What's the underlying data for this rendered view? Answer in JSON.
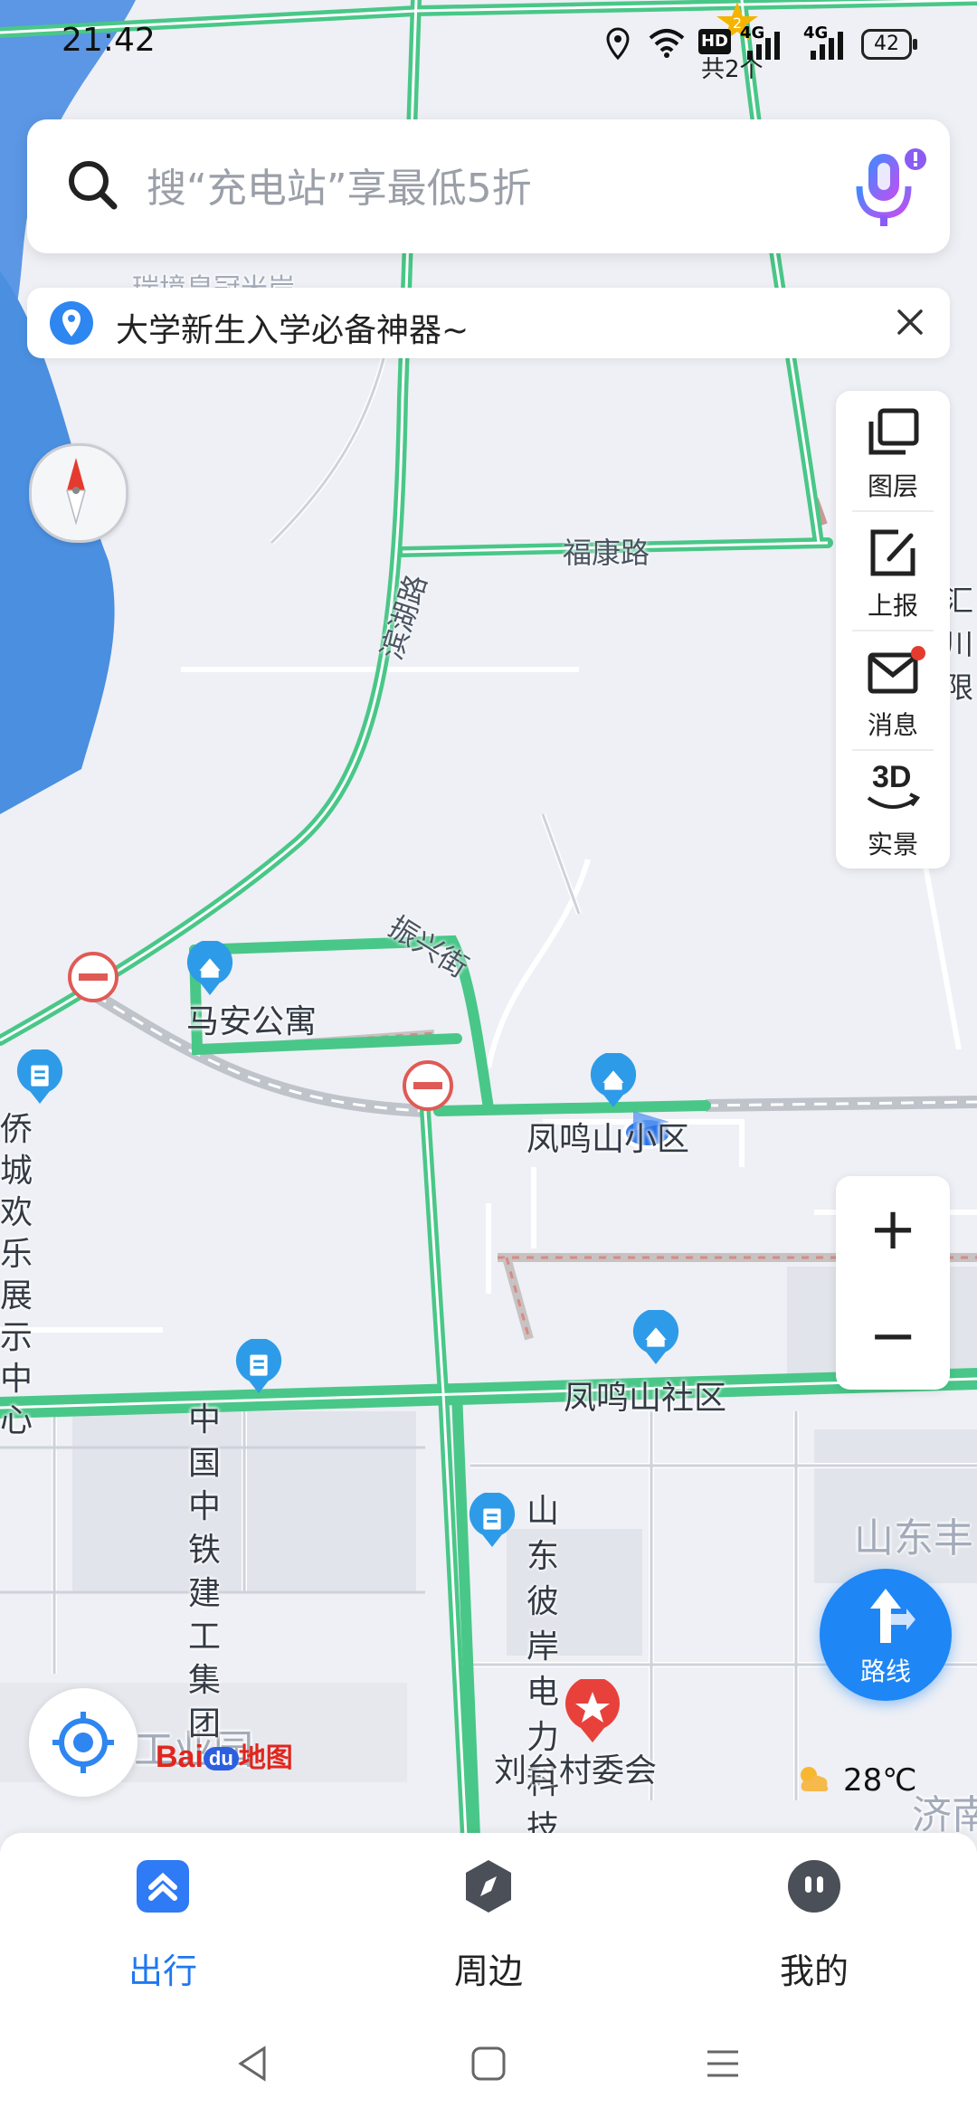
{
  "status_bar": {
    "time": "21:42",
    "badge_count": "共2个",
    "badge_number": "2",
    "battery": "42",
    "hd_label": "HD",
    "network_labels": [
      "4G",
      "4G"
    ]
  },
  "search": {
    "placeholder": "搜“充电站”享最低5折",
    "icon": "search-icon",
    "voice_icon": "microphone-icon"
  },
  "notice": {
    "text": "大学新生入学必备神器~",
    "icon": "location-pin-icon"
  },
  "tools": [
    {
      "label": "图层",
      "icon": "layers-icon"
    },
    {
      "label": "上报",
      "icon": "report-edit-icon"
    },
    {
      "label": "消息",
      "icon": "mail-icon"
    },
    {
      "label": "实景",
      "icon": "3d-view-icon",
      "icon_text": "3D"
    }
  ],
  "zoom": {
    "in": "+",
    "out": "−"
  },
  "route": {
    "label": "路线"
  },
  "map": {
    "roads": [
      "福康路",
      "滨湖路",
      "振兴街"
    ],
    "pois": [
      {
        "name": "马安公寓"
      },
      {
        "name": "凤鸣山小区"
      },
      {
        "name": "凤鸣山社区"
      },
      {
        "name": "中国中铁\n建工集团"
      },
      {
        "name": "山东彼岸电力\n科技有限公司"
      },
      {
        "name": "刘台村委会"
      },
      {
        "name": "侨城欢乐\n展示中心"
      }
    ],
    "faded_labels": [
      "工业园",
      "山东丰",
      "济南",
      "瑞境皇冠米岸"
    ],
    "edge_label": "汇川\n限"
  },
  "brand": {
    "logo_text": "Bai",
    "logo_du": "du",
    "logo_suffix": "地图"
  },
  "weather": {
    "temp": "28℃",
    "icon": "partly-cloudy-icon"
  },
  "bottom_nav": [
    {
      "label": "出行",
      "icon": "travel-icon",
      "active": true
    },
    {
      "label": "周边",
      "icon": "compass-nearby-icon",
      "active": false
    },
    {
      "label": "我的",
      "icon": "profile-icon",
      "active": false
    }
  ],
  "colors": {
    "accent": "#1f78f0",
    "road_green": "#49c788",
    "water": "#4a8fe0",
    "map_bg": "#eef0f5"
  }
}
